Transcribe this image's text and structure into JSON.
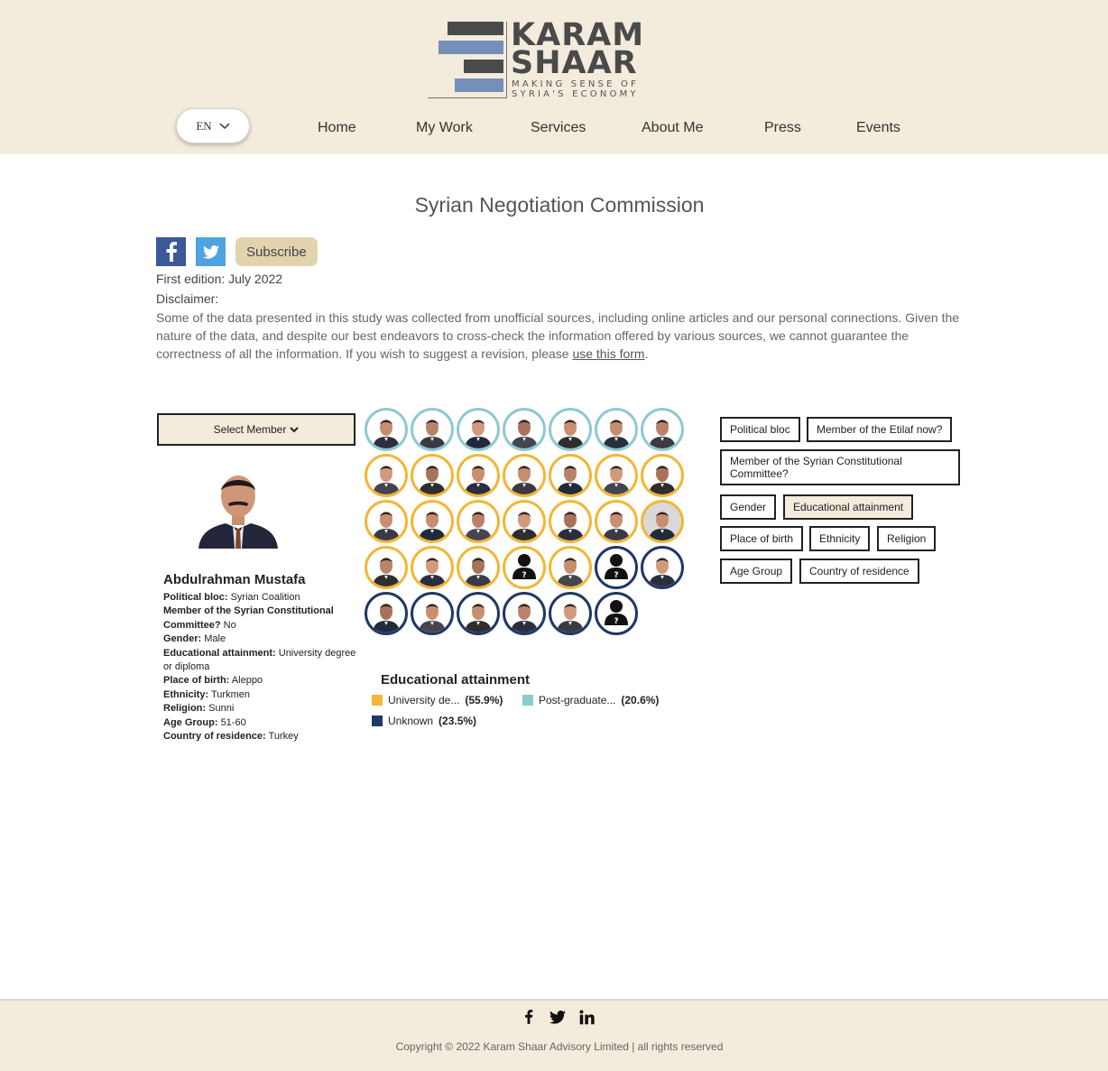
{
  "header": {
    "logo": {
      "line1": "KARAM",
      "line2": "SHAAR",
      "tagline1": "MAKING SENSE OF",
      "tagline2": "SYRIA'S ECONOMY"
    },
    "language": "EN",
    "nav": [
      "Home",
      "My Work",
      "Services",
      "About Me",
      "Press",
      "Events"
    ]
  },
  "page": {
    "title": "Syrian Negotiation Commission",
    "share": {
      "facebook_icon": "facebook-icon",
      "twitter_icon": "twitter-icon",
      "subscribe_label": "Subscribe"
    },
    "first_edition": "First edition: July 2022",
    "disclaimer_label": "Disclaimer:",
    "disclaimer_text": "Some of the data presented in this study was collected from unofficial sources, including online articles and our personal connections. Given the nature of the data, and despite our best endeavors to cross-check the information offered by various sources, we cannot guarantee the correctness of all the information. If you wish to suggest a revision, please ",
    "disclaimer_link": "use this form",
    "disclaimer_end": "."
  },
  "member_panel": {
    "select_label": "Select Member",
    "name": "Abdulrahman Mustafa",
    "fields": [
      {
        "label": "Political bloc:",
        "value": "Syrian Coalition"
      },
      {
        "label": "Member of the Syrian Constitutional Committee?",
        "value": "No"
      },
      {
        "label": "Gender:",
        "value": "Male"
      },
      {
        "label": "Educational attainment:",
        "value": "University degree or diploma"
      },
      {
        "label": "Place of birth:",
        "value": "Aleppo"
      },
      {
        "label": "Ethnicity:",
        "value": "Turkmen"
      },
      {
        "label": "Religion:",
        "value": "Sunni"
      },
      {
        "label": "Age Group:",
        "value": "51-60"
      },
      {
        "label": "Country of residence:",
        "value": "Turkey"
      }
    ]
  },
  "colors": {
    "university": "#f2b736",
    "postgraduate": "#8ec9d1",
    "unknown": "#1f3864",
    "beige": "#f3ebdc"
  },
  "grid_rings": [
    [
      "postgraduate",
      "postgraduate",
      "postgraduate",
      "postgraduate",
      "postgraduate",
      "postgraduate",
      "postgraduate"
    ],
    [
      "university",
      "university",
      "university",
      "university",
      "university",
      "university",
      "university"
    ],
    [
      "university",
      "university",
      "university",
      "university",
      "university",
      "university",
      "university"
    ],
    [
      "university",
      "university",
      "university",
      "university",
      "university",
      "unknown",
      "unknown"
    ],
    [
      "unknown",
      "unknown",
      "unknown",
      "unknown",
      "unknown",
      "unknown"
    ]
  ],
  "grid_unknown_photo": [
    [
      3,
      3
    ],
    [
      3,
      5
    ],
    [
      4,
      5
    ]
  ],
  "legend": {
    "title": "Educational attainment",
    "items": [
      {
        "label": "University de...",
        "pct": "(55.9%)",
        "color_key": "university"
      },
      {
        "label": "Post-graduate...",
        "pct": "(20.6%)",
        "color_key": "postgraduate"
      },
      {
        "label": "Unknown",
        "pct": "(23.5%)",
        "color_key": "unknown"
      }
    ]
  },
  "filters": [
    "Political bloc",
    "Member of the Etilaf now?",
    "Member of the Syrian Constitutional Committee?",
    "Gender",
    "Educational attainment",
    "Place of birth",
    "Ethnicity",
    "Religion",
    "Age Group",
    "Country of residence"
  ],
  "active_filter": "Educational attainment",
  "footer": {
    "social_icons": [
      "facebook-icon",
      "twitter-icon",
      "linkedin-icon"
    ],
    "copyright": "Copyright © 2022 Karam Shaar Advisory Limited | all rights reserved"
  }
}
